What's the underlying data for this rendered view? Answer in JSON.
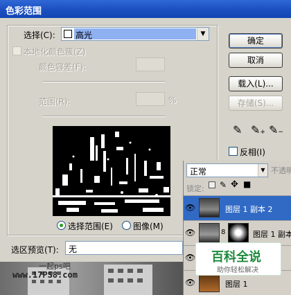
{
  "window": {
    "title": "色彩范围"
  },
  "select": {
    "label": "选择(C):",
    "value": "高光"
  },
  "localized": {
    "label": "本地化颜色簇(Z)"
  },
  "fuzziness": {
    "label": "颜色容差(F):"
  },
  "range": {
    "label": "范围(R):",
    "unit": "%"
  },
  "view": {
    "selection_label": "选择范围(E)",
    "image_label": "图像(M)",
    "selected": "selection"
  },
  "preview": {
    "label": "选区预览(T):",
    "value": "无"
  },
  "buttons": {
    "ok": "确定",
    "cancel": "取消",
    "load": "载入(L)...",
    "save": "存储(S)..."
  },
  "invert": {
    "label": "反相(I)"
  },
  "layers": {
    "blend_mode": "正常",
    "opacity_label": "不透明",
    "lock_label": "锁定:",
    "rows": [
      {
        "name": "图层 1 副本 2",
        "selected": true
      },
      {
        "name": "图层 1 副本",
        "selected": false
      },
      {
        "name": "",
        "selected": false
      },
      {
        "name": "图层 1",
        "selected": false
      }
    ]
  },
  "watermark": {
    "text": "百科全说",
    "subtext": "助你轻松解决"
  },
  "site": {
    "text": "一起ps吧",
    "url": "www.17PS8.com"
  },
  "colors": {
    "accent": "#2f68d6",
    "selection": "#8fb1f1"
  }
}
